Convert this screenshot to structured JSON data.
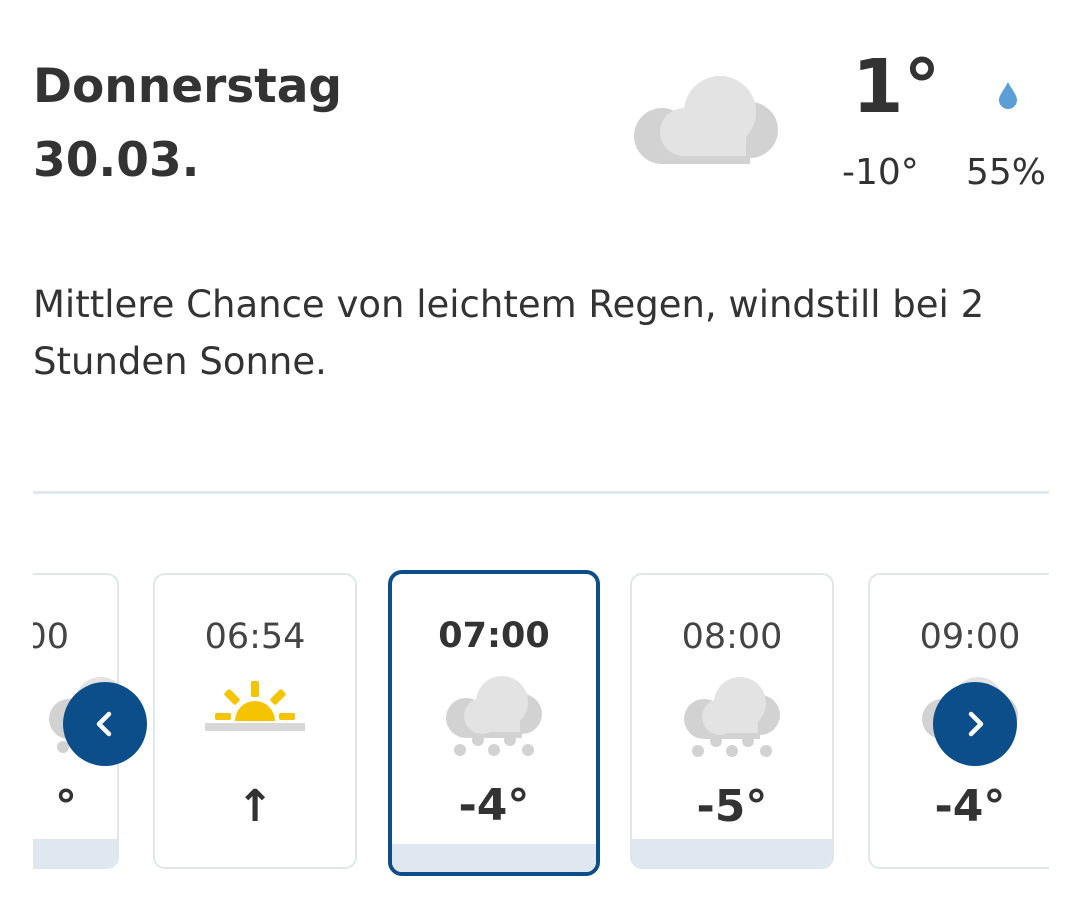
{
  "header": {
    "day": "Donnerstag",
    "date": "30.03.",
    "temp_max": "1°",
    "temp_min": "-10°",
    "precip": "55%",
    "weather_icon": "cloud-icon"
  },
  "description": "Mittlere Chance von leichtem Regen, windstill bei 2 Stunden Sonne.",
  "hours": [
    {
      "time": "00",
      "temp": "°",
      "icon": "cloud-snow-icon"
    },
    {
      "time": "06:54",
      "temp": "↑",
      "icon": "sunrise-icon"
    },
    {
      "time": "07:00",
      "temp": "-4°",
      "icon": "cloud-snow-icon",
      "selected": true
    },
    {
      "time": "08:00",
      "temp": "-5°",
      "icon": "cloud-snow-icon"
    },
    {
      "time": "09:00",
      "temp": "-4°",
      "icon": "cloud-snow-icon"
    }
  ],
  "nav": {
    "prev_icon": "chevron-left-icon",
    "next_icon": "chevron-right-icon"
  },
  "colors": {
    "accent": "#0c4e8a",
    "divider": "#e2e9ee",
    "bar": "#dfe8f1",
    "sun": "#f5c400",
    "drop": "#5b9fd6"
  }
}
